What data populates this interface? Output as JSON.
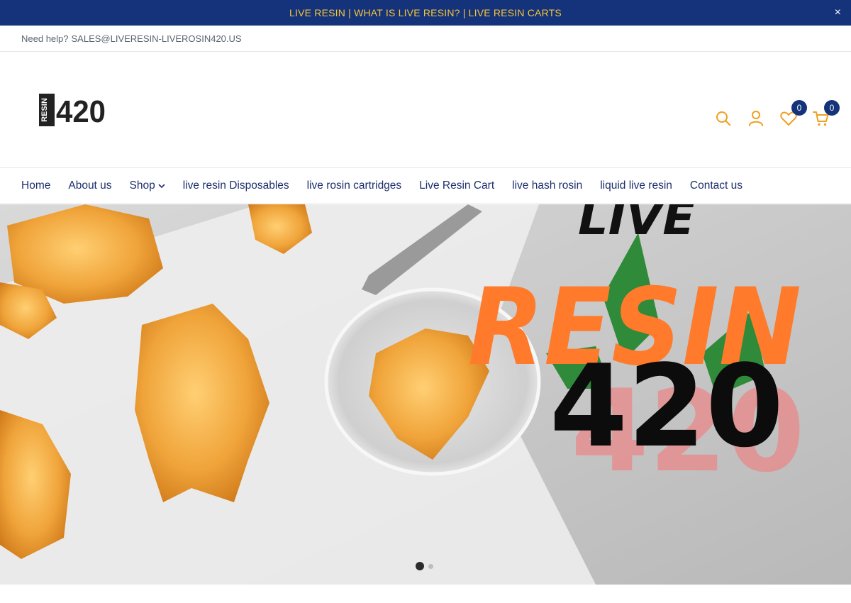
{
  "announcement": {
    "text": "LIVE RESIN | WHAT IS LIVE RESIN? | LIVE RESIN CARTS",
    "close_glyph": "×",
    "bg_color": "#15337a",
    "text_color": "#f6c53b"
  },
  "helpbar": {
    "label": "Need help?",
    "email": "SALES@LIVERESIN-LIVEROSIN420.US"
  },
  "logo": {
    "side_text": "RESIN",
    "number": "420"
  },
  "header_icons": {
    "search_icon": "search-icon",
    "account_icon": "user-icon",
    "wishlist_icon": "heart-icon",
    "wishlist_count": "0",
    "cart_icon": "cart-icon",
    "cart_count": "0",
    "icon_color": "#f0a020"
  },
  "nav": {
    "items": [
      "Home",
      "About us",
      "Shop",
      "live resin Disposables",
      "live rosin cartridges",
      "Live Resin Cart",
      "live hash rosin",
      "liquid live resin",
      "Contact us"
    ]
  },
  "hero": {
    "line1": "LIVE",
    "line2": "RESIN",
    "line3": "420",
    "slide_count": 2,
    "active_slide": 1
  }
}
